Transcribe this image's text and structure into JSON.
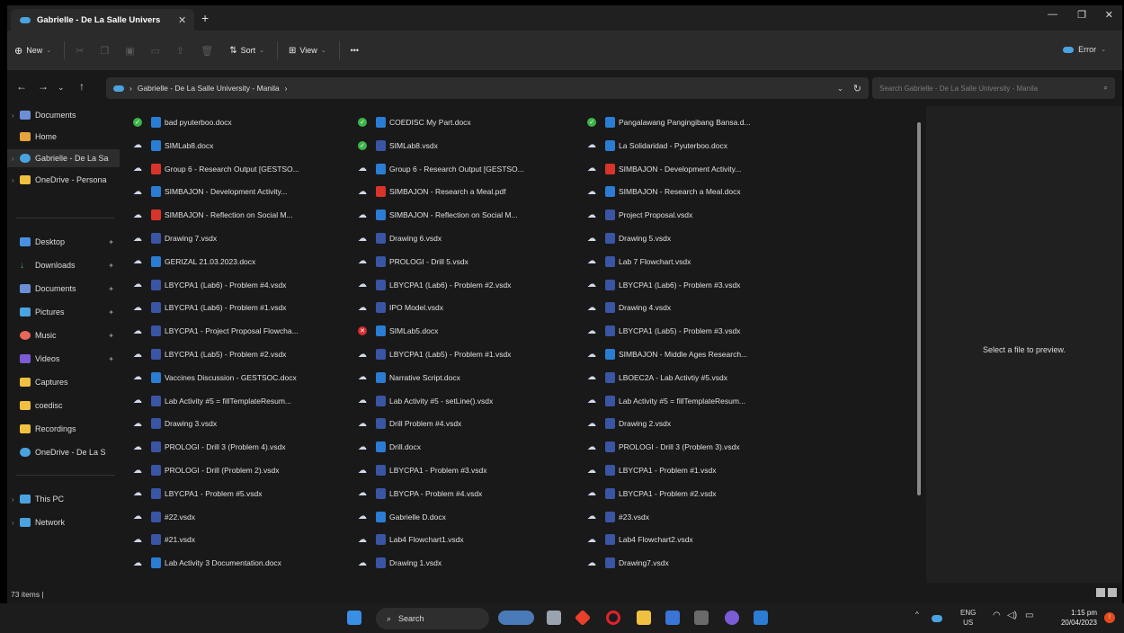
{
  "window": {
    "tab_title": "Gabrielle - De La Salle Univers",
    "tab_close": "✕",
    "new_tab": "+",
    "minimize": "—",
    "maximize": "❐",
    "close": "✕"
  },
  "toolbar": {
    "new_label": "New",
    "sort_label": "Sort",
    "view_label": "View",
    "more_label": "•••",
    "error_label": "Error"
  },
  "address": {
    "path": "Gabrielle - De La Salle University - Manila",
    "search_placeholder": "Search Gabrielle - De La Salle University - Manila"
  },
  "sidebar": {
    "items": [
      {
        "label": "Documents",
        "color": "#6b8fd6"
      },
      {
        "label": "Home",
        "color": "#e8a33d"
      },
      {
        "label": "Gabrielle - De La Sa",
        "color": "#4aa3df"
      },
      {
        "label": "OneDrive - Persona",
        "color": "#f0c040"
      },
      {
        "label": "Desktop",
        "color": "#4a90e2"
      },
      {
        "label": "Downloads",
        "color": "#3bb54a"
      },
      {
        "label": "Documents",
        "color": "#6b8fd6"
      },
      {
        "label": "Pictures",
        "color": "#4aa3df"
      },
      {
        "label": "Music",
        "color": "#e8665a"
      },
      {
        "label": "Videos",
        "color": "#7b5bd6"
      },
      {
        "label": "Captures",
        "color": "#f0c040"
      },
      {
        "label": "coedisc",
        "color": "#f0c040"
      },
      {
        "label": "Recordings",
        "color": "#f0c040"
      },
      {
        "label": "OneDrive - De La S",
        "color": "#4aa3df"
      },
      {
        "label": "This PC",
        "color": "#4aa3df"
      },
      {
        "label": "Network",
        "color": "#4aa3df"
      }
    ]
  },
  "files": {
    "col1": [
      {
        "name": "bad pyuterboo.docx",
        "status": "ok",
        "type": "word"
      },
      {
        "name": "SIMLab8.docx",
        "status": "cloud",
        "type": "word"
      },
      {
        "name": "Group 6 - Research Output [GESTSO...",
        "status": "cloud",
        "type": "pdf"
      },
      {
        "name": "SIMBAJON - Development Activity...",
        "status": "cloud",
        "type": "word"
      },
      {
        "name": "SIMBAJON - Reflection on Social M...",
        "status": "cloud",
        "type": "pdf"
      },
      {
        "name": "Drawing 7.vsdx",
        "status": "cloud",
        "type": "visio"
      },
      {
        "name": "GERIZAL 21.03.2023.docx",
        "status": "cloud",
        "type": "word"
      },
      {
        "name": "LBYCPA1 (Lab6) - Problem #4.vsdx",
        "status": "cloud",
        "type": "visio"
      },
      {
        "name": "LBYCPA1 (Lab6) - Problem #1.vsdx",
        "status": "cloud",
        "type": "visio"
      },
      {
        "name": "LBYCPA1 - Project Proposal Flowcha...",
        "status": "cloud",
        "type": "visio"
      },
      {
        "name": "LBYCPA1 (Lab5) - Problem #2.vsdx",
        "status": "cloud",
        "type": "visio"
      },
      {
        "name": "Vaccines Discussion - GESTSOC.docx",
        "status": "cloud",
        "type": "word"
      },
      {
        "name": "Lab Activity #5 = fillTemplateResum...",
        "status": "cloud",
        "type": "visio"
      },
      {
        "name": "Drawing 3.vsdx",
        "status": "cloud",
        "type": "visio"
      },
      {
        "name": "PROLOGI - Drill 3 (Problem 4).vsdx",
        "status": "cloud",
        "type": "visio"
      },
      {
        "name": "PROLOGI - Drill (Problem 2).vsdx",
        "status": "cloud",
        "type": "visio"
      },
      {
        "name": "LBYCPA1 - Problem #5.vsdx",
        "status": "cloud",
        "type": "visio"
      },
      {
        "name": "#22.vsdx",
        "status": "cloud",
        "type": "visio"
      },
      {
        "name": "#21.vsdx",
        "status": "cloud",
        "type": "visio"
      },
      {
        "name": "Lab Activity 3 Documentation.docx",
        "status": "cloud",
        "type": "word"
      }
    ],
    "col2": [
      {
        "name": "COEDISC My Part.docx",
        "status": "ok",
        "type": "word"
      },
      {
        "name": "SIMLab8.vsdx",
        "status": "ok",
        "type": "visio"
      },
      {
        "name": "Group 6 - Research Output [GESTSO...",
        "status": "cloud",
        "type": "word"
      },
      {
        "name": "SIMBAJON - Research a Meal.pdf",
        "status": "cloud",
        "type": "pdf"
      },
      {
        "name": "SIMBAJON - Reflection on Social M...",
        "status": "cloud",
        "type": "word"
      },
      {
        "name": "Drawing 6.vsdx",
        "status": "cloud",
        "type": "visio"
      },
      {
        "name": "PROLOGI - Drill 5.vsdx",
        "status": "cloud",
        "type": "visio"
      },
      {
        "name": "LBYCPA1 (Lab6) - Problem #2.vsdx",
        "status": "cloud",
        "type": "visio"
      },
      {
        "name": "IPO Model.vsdx",
        "status": "cloud",
        "type": "visio"
      },
      {
        "name": "SIMLab5.docx",
        "status": "err",
        "type": "word"
      },
      {
        "name": "LBYCPA1 (Lab5) - Problem #1.vsdx",
        "status": "cloud",
        "type": "visio"
      },
      {
        "name": "Narrative Script.docx",
        "status": "cloud",
        "type": "word"
      },
      {
        "name": "Lab Activity #5 - setLine().vsdx",
        "status": "cloud",
        "type": "visio"
      },
      {
        "name": "Drill Problem #4.vsdx",
        "status": "cloud",
        "type": "visio"
      },
      {
        "name": "Drill.docx",
        "status": "cloud",
        "type": "word"
      },
      {
        "name": "LBYCPA1 - Problem #3.vsdx",
        "status": "cloud",
        "type": "visio"
      },
      {
        "name": "LBYCPA - Problem #4.vsdx",
        "status": "cloud",
        "type": "visio"
      },
      {
        "name": "Gabrielle D.docx",
        "status": "cloud",
        "type": "word"
      },
      {
        "name": "Lab4 Flowchart1.vsdx",
        "status": "cloud",
        "type": "visio"
      },
      {
        "name": "Drawing 1.vsdx",
        "status": "cloud",
        "type": "visio"
      }
    ],
    "col3": [
      {
        "name": "Pangalawang Pangingibang Bansa.d...",
        "status": "ok",
        "type": "word"
      },
      {
        "name": "La Solidaridad - Pyuterboo.docx",
        "status": "cloud",
        "type": "word"
      },
      {
        "name": "SIMBAJON - Development Activity...",
        "status": "cloud",
        "type": "pdf"
      },
      {
        "name": "SIMBAJON - Research a Meal.docx",
        "status": "cloud",
        "type": "word"
      },
      {
        "name": "Project Proposal.vsdx",
        "status": "cloud",
        "type": "visio"
      },
      {
        "name": "Drawing 5.vsdx",
        "status": "cloud",
        "type": "visio"
      },
      {
        "name": "Lab 7 Flowchart.vsdx",
        "status": "cloud",
        "type": "visio"
      },
      {
        "name": "LBYCPA1 (Lab6) - Problem #3.vsdx",
        "status": "cloud",
        "type": "visio"
      },
      {
        "name": "Drawing 4.vsdx",
        "status": "cloud",
        "type": "visio"
      },
      {
        "name": "LBYCPA1 (Lab5) - Problem #3.vsdx",
        "status": "cloud",
        "type": "visio"
      },
      {
        "name": "SIMBAJON - Middle Ages Research...",
        "status": "cloud",
        "type": "word"
      },
      {
        "name": "LBOEC2A - Lab Activtiy #5.vsdx",
        "status": "cloud",
        "type": "visio"
      },
      {
        "name": "Lab Activity #5 = fillTemplateResum...",
        "status": "cloud",
        "type": "visio"
      },
      {
        "name": "Drawing 2.vsdx",
        "status": "cloud",
        "type": "visio"
      },
      {
        "name": "PROLOGI - Drill 3 (Problem 3).vsdx",
        "status": "cloud",
        "type": "visio"
      },
      {
        "name": "LBYCPA1 - Problem #1.vsdx",
        "status": "cloud",
        "type": "visio"
      },
      {
        "name": "LBYCPA1 - Problem #2.vsdx",
        "status": "cloud",
        "type": "visio"
      },
      {
        "name": "#23.vsdx",
        "status": "cloud",
        "type": "visio"
      },
      {
        "name": "Lab4 Flowchart2.vsdx",
        "status": "cloud",
        "type": "visio"
      },
      {
        "name": "Drawing7.vsdx",
        "status": "cloud",
        "type": "visio"
      }
    ]
  },
  "preview": {
    "text": "Select a file to preview."
  },
  "status": {
    "items_count": "73 items |"
  },
  "taskbar": {
    "search_label": "Search",
    "lang_top": "ENG",
    "lang_bottom": "US",
    "time": "1:15 pm",
    "date": "20/04/2023"
  }
}
